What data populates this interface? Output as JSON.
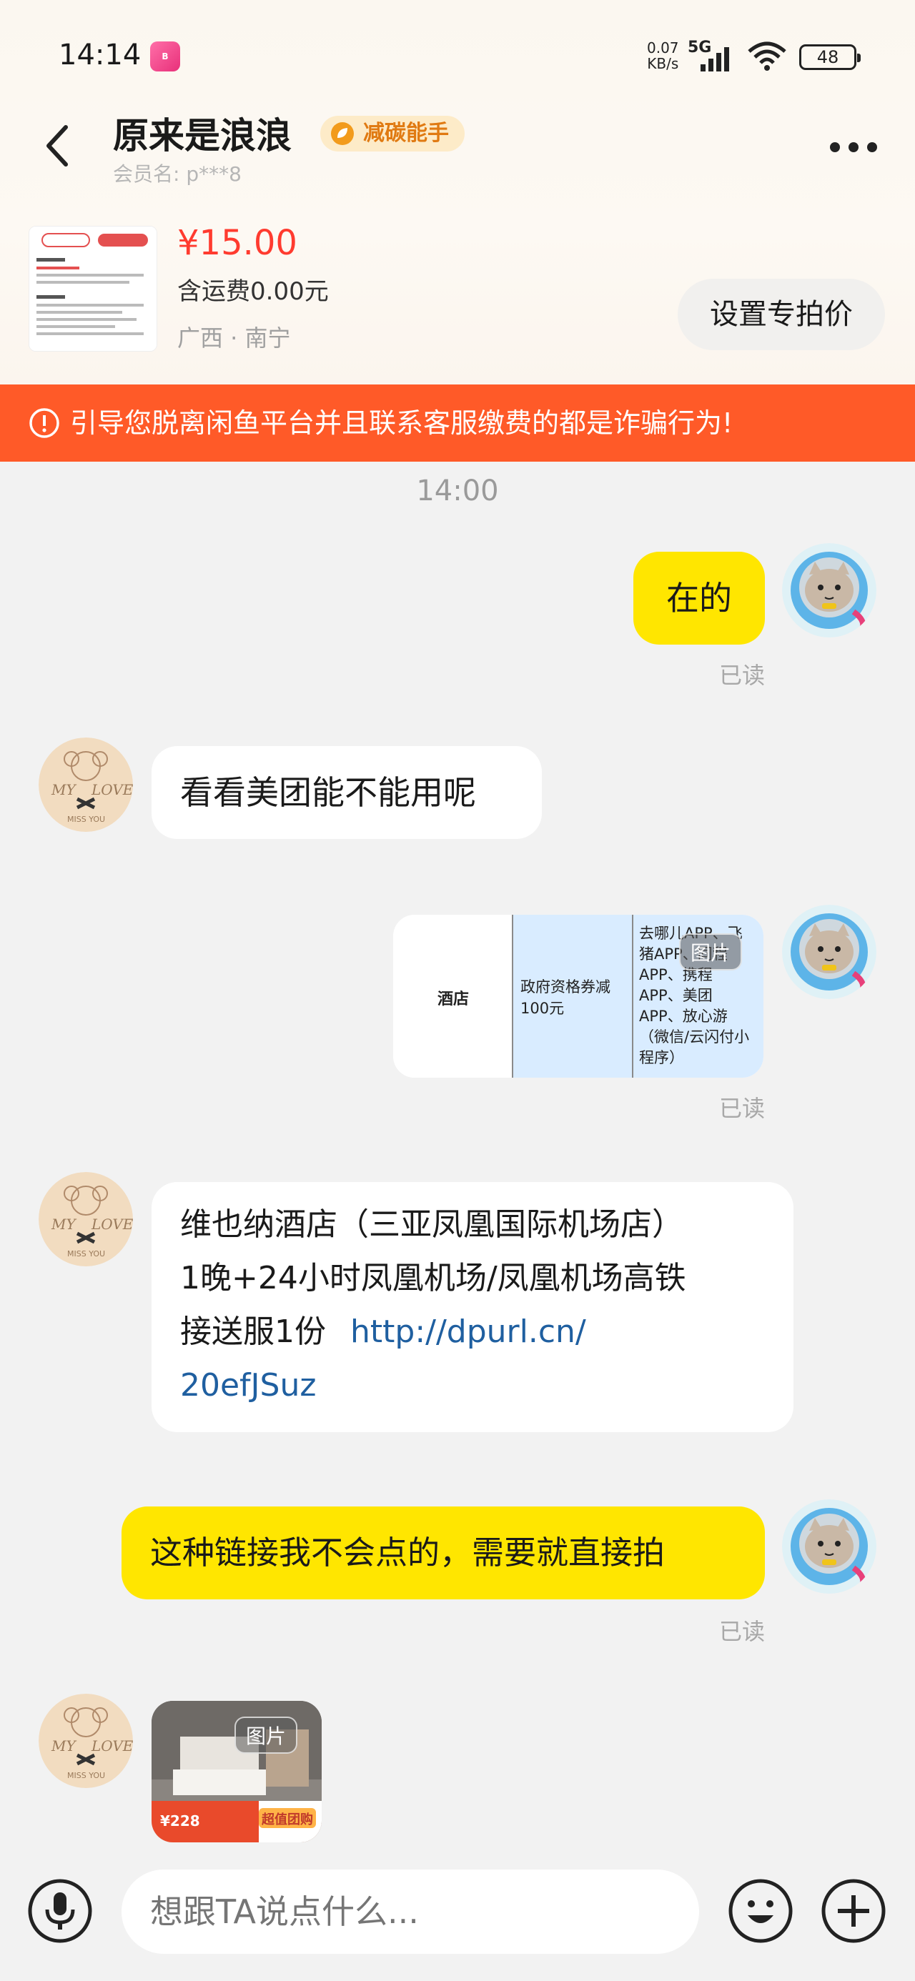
{
  "status_bar": {
    "time": "14:14",
    "app_badge": "bilibili",
    "net_speed_value": "0.07",
    "net_speed_unit": "KB/s",
    "network": "5G",
    "battery": "48"
  },
  "header": {
    "title": "原来是浪浪",
    "badge": "减碳能手",
    "member": "会员名: p***8"
  },
  "product": {
    "price": "¥15.00",
    "shipping": "含运费0.00元",
    "location": "广西 · 南宁",
    "set_price_label": "设置专拍价"
  },
  "warning": "引导您脱离闲鱼平台并且联系客服缴费的都是诈骗行为!",
  "chat": {
    "time": "14:00",
    "read_label": "已读",
    "img_tag": "图片",
    "messages": [
      {
        "text": "在的"
      },
      {
        "text": "看看美团能不能用呢"
      },
      {
        "col1": "酒店",
        "col2": "政府资格券减100元",
        "col3": "去哪儿APP、飞猪APP、同程APP、携程APP、美团APP、放心游（微信/云闪付小程序）"
      },
      {
        "line1": "维也纳酒店（三亚凤凰国际机场店）",
        "line2": "1晚+24小时凤凰机场/凤凰机场高铁",
        "line3": "接送服1份",
        "link_part1": "http://dpurl.cn/",
        "link_part2": "20efJSuz"
      },
      {
        "text": "这种链接我不会点的，需要就直接拍"
      },
      {
        "price_tag": "¥228",
        "banner": "超值团购"
      }
    ]
  },
  "input": {
    "placeholder": "想跟TA说点什么..."
  },
  "colors": {
    "accent_yellow": "#ffe600",
    "warning_orange": "#ff5a28",
    "price_red": "#ff3b2f",
    "link_blue": "#1f5fa0"
  },
  "icons": [
    "back-arrow-icon",
    "more-icon",
    "leaf-icon",
    "warning-icon",
    "mic-icon",
    "emoji-icon",
    "plus-icon",
    "signal-icon",
    "wifi-icon"
  ]
}
